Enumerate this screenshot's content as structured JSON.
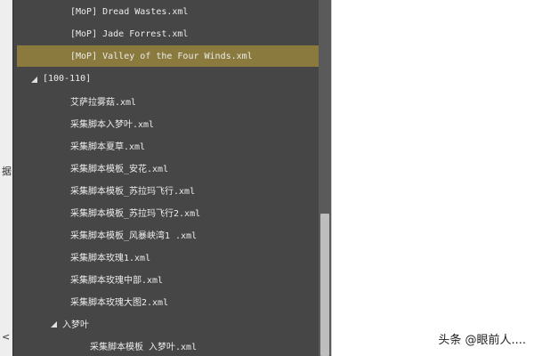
{
  "left_strip": {
    "marks": [
      "据",
      "<"
    ]
  },
  "tree": {
    "items": [
      {
        "label": "[MoP] Dread Wastes.xml",
        "indent": 2,
        "selected": false
      },
      {
        "label": "[MoP] Jade Forrest.xml",
        "indent": 2,
        "selected": false
      },
      {
        "label": "[MoP] Valley of the Four Winds.xml",
        "indent": 2,
        "selected": true
      },
      {
        "label": "[100-110]",
        "indent": 1,
        "expander": true,
        "selected": false
      },
      {
        "label": "艾萨拉雾菇.xml",
        "indent": 2,
        "selected": false
      },
      {
        "label": "采集脚本入梦叶.xml",
        "indent": 2,
        "selected": false
      },
      {
        "label": "采集脚本夏草.xml",
        "indent": 2,
        "selected": false
      },
      {
        "label": "采集脚本模板_安花.xml",
        "indent": 2,
        "selected": false
      },
      {
        "label": "采集脚本模板_苏拉玛飞行.xml",
        "indent": 2,
        "selected": false
      },
      {
        "label": "采集脚本模板_苏拉玛飞行2.xml",
        "indent": 2,
        "selected": false
      },
      {
        "label": "采集脚本模板_风暴峡湾1 .xml",
        "indent": 2,
        "selected": false
      },
      {
        "label": "采集脚本玫瑰1.xml",
        "indent": 2,
        "selected": false
      },
      {
        "label": "采集脚本玫瑰中部.xml",
        "indent": 2,
        "selected": false
      },
      {
        "label": "采集脚本玫瑰大图2.xml",
        "indent": 2,
        "selected": false
      },
      {
        "label": "入梦叶",
        "indent": 2,
        "expander": true,
        "selected": false
      },
      {
        "label": "采集脚本模板 入梦叶.xml",
        "indent": 3,
        "selected": false
      }
    ]
  },
  "scrollbar": {
    "thumb_start": 0.6,
    "thumb_end": 1.0
  },
  "watermark": {
    "text": "头条 @眼前人...."
  },
  "colors": {
    "panel_bg": "#464646",
    "selection": "#8a7a3e",
    "text": "#ececec"
  }
}
